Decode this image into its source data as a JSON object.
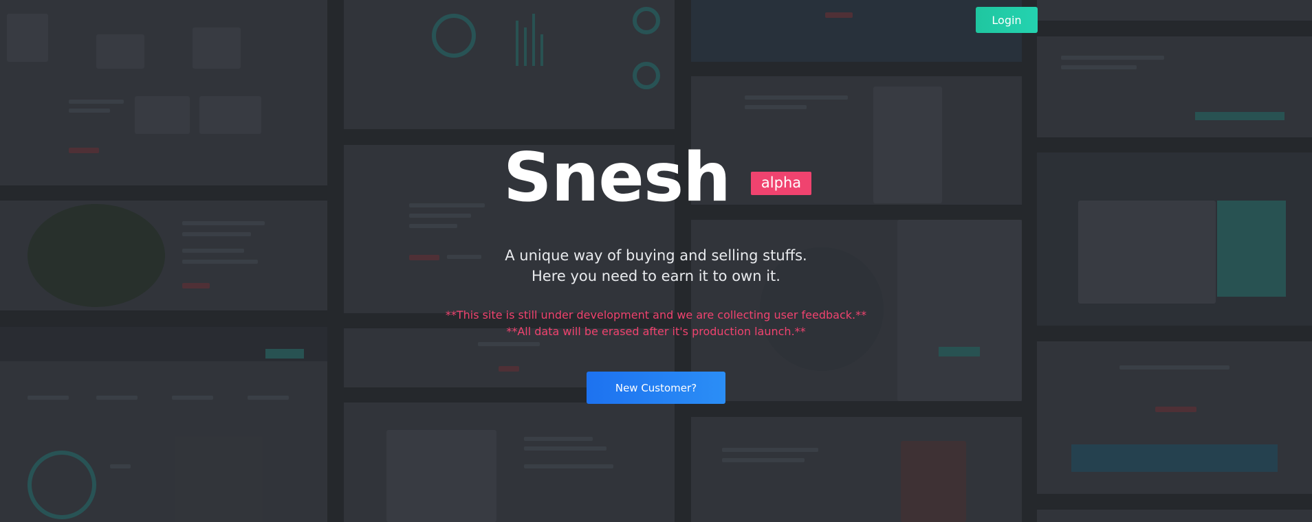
{
  "header": {
    "login_label": "Login"
  },
  "hero": {
    "title": "Snesh",
    "badge": "alpha",
    "tagline_line1": "A unique way of buying and selling stuffs.",
    "tagline_line2": "Here you need to earn it to own it.",
    "notice_line1": "**This site is still under development and we are collecting user feedback.**",
    "notice_line2": "**All data will be erased after it's production launch.**",
    "cta_label": "New Customer?"
  },
  "colors": {
    "login_button": "#1fc6a0",
    "badge": "#f0436f",
    "notice_text": "#f0436f",
    "cta_button": "#1d72f0",
    "background": "#2a2d31"
  }
}
